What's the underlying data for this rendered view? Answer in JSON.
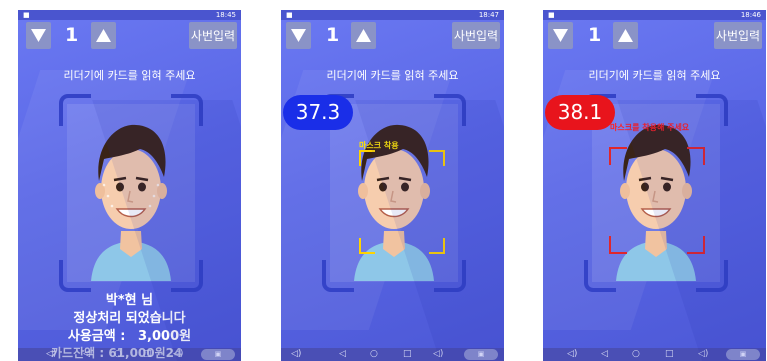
{
  "status_bar": {
    "left_icon": "sim-icon",
    "screen1_time": "18:45",
    "screen2_time": "18:47",
    "screen3_time": "18:46"
  },
  "top_bar": {
    "count": "1",
    "employee_id_label": "사번입력"
  },
  "instruction": "리더기에 카드를 읽혀 주세요",
  "screen1": {
    "name": "박*현   님",
    "message": "정상처리 되었습니다",
    "amount_label": "사용금액 :",
    "amount_value": "3,000원",
    "overlay": "카드잔액 : 61,000원24"
  },
  "screen2": {
    "temperature": "37.3",
    "temperature_color": "#1a2ee8",
    "mask_label": "마스크 착용",
    "mask_label_color": "#ffe600"
  },
  "screen3": {
    "temperature": "38.1",
    "temperature_color": "#e8141c",
    "mask_label": "마스크를 착용해 주세요",
    "mask_label_color": "#ff2020"
  },
  "nav": {
    "icons": [
      "volume-icon",
      "back-icon",
      "home-icon",
      "recents-icon",
      "volume-up-icon",
      "screenshot-icon"
    ]
  }
}
